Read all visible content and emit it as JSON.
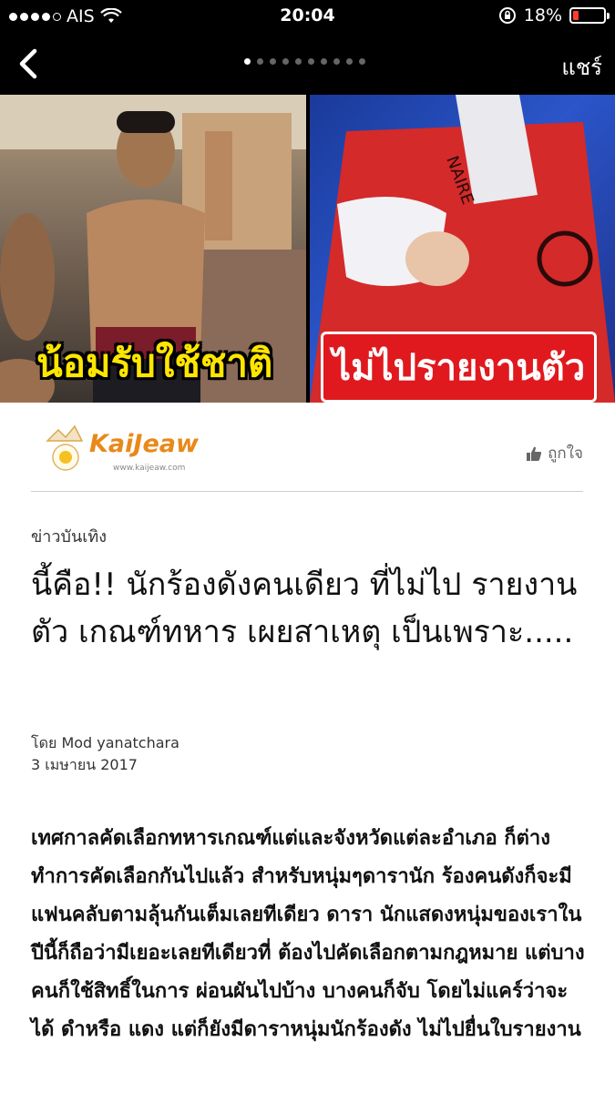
{
  "status_bar": {
    "carrier": "AIS",
    "time": "20:04",
    "battery_percent": "18%",
    "battery_level": 0.18,
    "battery_color": "#ff3b30",
    "icons": [
      "signal-dots",
      "wifi-icon",
      "rotation-lock-icon",
      "battery-icon"
    ]
  },
  "nav": {
    "back_icon": "chevron-left-icon",
    "share_label": "แชร์",
    "page_count": 10,
    "active_page": 1
  },
  "hero": {
    "caption_left": "น้อมรับใช้ชาติ",
    "caption_right": "ไม่ไปรายงานตัว",
    "caption_left_color": "#ffe600",
    "caption_right_bg": "#e0191e"
  },
  "publisher": {
    "name": "KaiJeaw",
    "url": "www.kaijeaw.com",
    "like_label": "ถูกใจ",
    "like_icon": "thumbs-up-icon"
  },
  "article": {
    "category": "ข่าวบันเทิง",
    "title": "นี้คือ!! นักร้องดังคนเดียว ที่ไม่ไป รายงานตัว เกณฑ์ทหาร เผยสาเหตุ เป็นเพราะ.....",
    "author": "โดย Mod yanatchara",
    "date": "3 เมษายน 2017",
    "body": "เทศกาลคัดเลือกทหารเกณฑ์แต่และจังหวัดแต่ละอำเภอ ก็ต่างทำการคัดเลือกกันไปแล้ว สำหรับหนุ่มๆดารานัก ร้องคนดังก็จะมีแฟนคลับตามลุ้นกันเต็มเลยทีเดียว ดารา นักแสดงหนุ่มของเราในปีนี้ก็ถือว่ามีเยอะเลยทีเดียวที่ ต้องไปคัดเลือกตามกฎหมาย แต่บางคนก็ใช้สิทธิ์ในการ ผ่อนผันไปบ้าง บางคนก็จับ โดยไม่แคร์ว่าจะได้ ดำหรือ แดง แต่ก็ยังมีดาราหนุ่มนักร้องดัง ไม่ไปยื่นใบรายงาน"
  }
}
